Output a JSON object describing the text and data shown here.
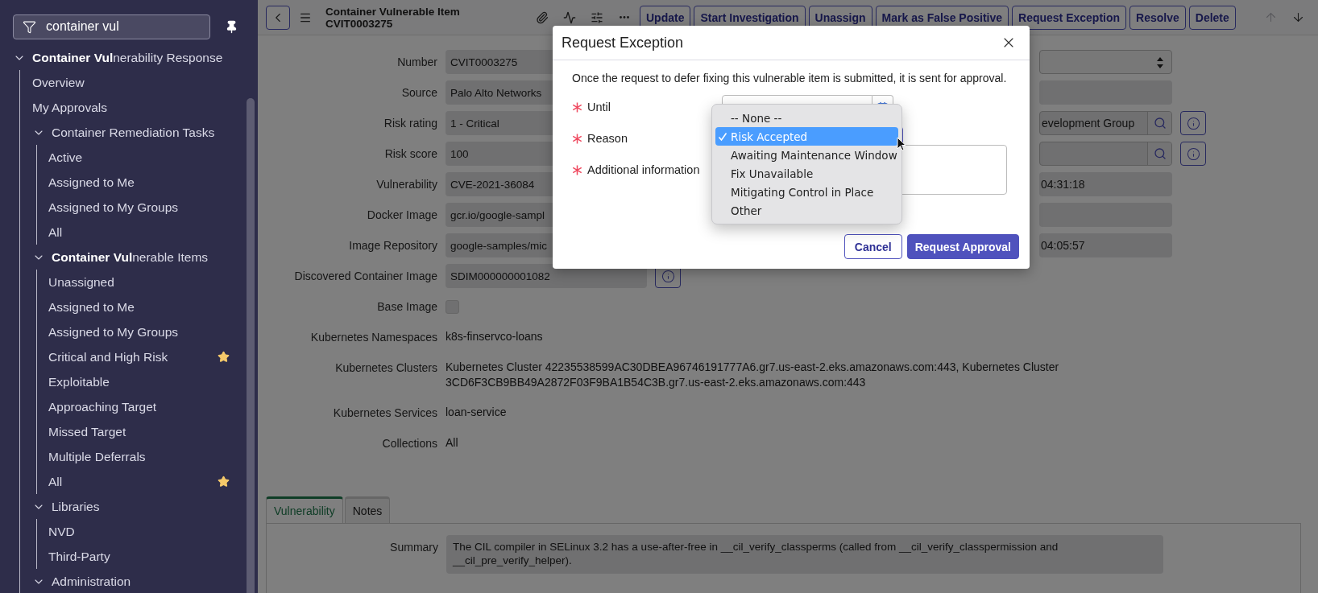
{
  "sidebar": {
    "filter": {
      "value": "container vul"
    },
    "tree": [
      {
        "label": "**Container Vul**nerability Response",
        "expanded": true,
        "children": [
          {
            "label": "Overview",
            "favorite": false
          },
          {
            "label": "My Approvals",
            "favorite": false
          },
          {
            "label": "Container Remediation Tasks",
            "expanded": true,
            "children": [
              {
                "label": "Active",
                "favorite": false
              },
              {
                "label": "Assigned to Me",
                "favorite": false
              },
              {
                "label": "Assigned to My Groups",
                "favorite": false
              },
              {
                "label": "All",
                "favorite": false
              }
            ]
          },
          {
            "label": "**Container Vul**nerable Items",
            "expanded": true,
            "children": [
              {
                "label": "Unassigned",
                "favorite": false
              },
              {
                "label": "Assigned to Me",
                "favorite": false
              },
              {
                "label": "Assigned to My Groups",
                "favorite": false
              },
              {
                "label": "Critical and High Risk",
                "favorite": true
              },
              {
                "label": "Exploitable",
                "favorite": false
              },
              {
                "label": "Approaching Target",
                "favorite": false
              },
              {
                "label": "Missed Target",
                "favorite": false
              },
              {
                "label": "Multiple Deferrals",
                "favorite": false
              },
              {
                "label": "All",
                "favorite": true
              }
            ]
          },
          {
            "label": "Libraries",
            "expanded": true,
            "children": [
              {
                "label": "NVD",
                "favorite": false
              },
              {
                "label": "Third-Party",
                "favorite": false
              }
            ]
          },
          {
            "label": "Administration",
            "expanded": true
          }
        ]
      }
    ]
  },
  "record": {
    "title": "Container Vulnerable Item",
    "number": "CVIT0003275",
    "actions": [
      {
        "label": "Update"
      },
      {
        "label": "Start Investigation"
      },
      {
        "label": "Unassign"
      },
      {
        "label": "Mark as False Positive"
      },
      {
        "label": "Request Exception"
      },
      {
        "label": "Resolve"
      },
      {
        "label": "Delete"
      }
    ],
    "nav": [
      {
        "kind": "up",
        "disabled": true
      },
      {
        "kind": "down",
        "disabled": false
      }
    ]
  },
  "form": {
    "left": [
      {
        "label": "Number",
        "kind": "field",
        "value": "CVIT0003275"
      },
      {
        "label": "Source",
        "kind": "field",
        "value": "Palo Alto Networks"
      },
      {
        "label": "Risk rating",
        "kind": "field",
        "value": "1 - Critical"
      },
      {
        "label": "Risk score",
        "kind": "field",
        "value": "100"
      },
      {
        "label": "Vulnerability",
        "kind": "field",
        "value": "CVE-2021-36084"
      },
      {
        "label": "Docker Image",
        "kind": "field",
        "value": "gcr.io/google-sampl"
      },
      {
        "label": "Image Repository",
        "kind": "field",
        "value": "google-samples/mic"
      },
      {
        "label": "Discovered Container Image",
        "kind": "reference",
        "value": "SDIM000000001082"
      },
      {
        "label": "Base Image",
        "kind": "checkbox",
        "checked": false
      },
      {
        "label": "Kubernetes Namespaces",
        "kind": "text",
        "value": "k8s-finservco-loans"
      },
      {
        "label": "Kubernetes Clusters",
        "kind": "text",
        "value": "Kubernetes Cluster 42235538599AC30DBEA96746191777A6.gr7.us-east-2.eks.amazonaws.com:443, Kubernetes Cluster 3CD6F3CB9BB49A2872F03F9BA1B54C3B.gr7.us-east-2.eks.amazonaws.com:443"
      },
      {
        "label": "Kubernetes Services",
        "kind": "text",
        "value": "loan-service"
      },
      {
        "label": "Collections",
        "kind": "text",
        "value": "All"
      }
    ],
    "right": [
      {
        "kind": "select"
      },
      {
        "kind": "field"
      },
      {
        "kind": "lookup",
        "value": "evelopment Group"
      },
      {
        "kind": "lookup"
      },
      {
        "kind": "field",
        "value": "04:31:18"
      },
      {
        "kind": "field"
      },
      {
        "kind": "field",
        "value": "04:05:57"
      }
    ]
  },
  "tabs": [
    {
      "label": "Vulnerability",
      "selected": true
    },
    {
      "label": "Notes",
      "selected": false
    }
  ],
  "summary": {
    "label": "Summary",
    "value": "The CIL compiler in SELinux 3.2 has a use-after-free in __cil_verify_classperms (called from __cil_verify_classpermission and __cil_pre_verify_helper)."
  },
  "modal": {
    "title": "Request Exception",
    "description": "Once the request to defer fixing this vulnerable item is submitted, it is sent for approval.",
    "fields": [
      {
        "label": "Until",
        "kind": "date",
        "required": true
      },
      {
        "label": "Reason",
        "kind": "select",
        "required": true,
        "options": [
          {
            "label": "-- None --",
            "selected": false
          },
          {
            "label": "Risk Accepted",
            "selected": true
          },
          {
            "label": "Awaiting Maintenance Window",
            "selected": false
          },
          {
            "label": "Fix Unavailable",
            "selected": false
          },
          {
            "label": "Mitigating Control in Place",
            "selected": false
          },
          {
            "label": "Other",
            "selected": false
          }
        ]
      },
      {
        "label": "Additional information",
        "kind": "textarea",
        "required": true
      }
    ],
    "buttons": [
      {
        "label": "Cancel",
        "kind": "secondary"
      },
      {
        "label": "Request Approval",
        "kind": "primary"
      }
    ]
  }
}
